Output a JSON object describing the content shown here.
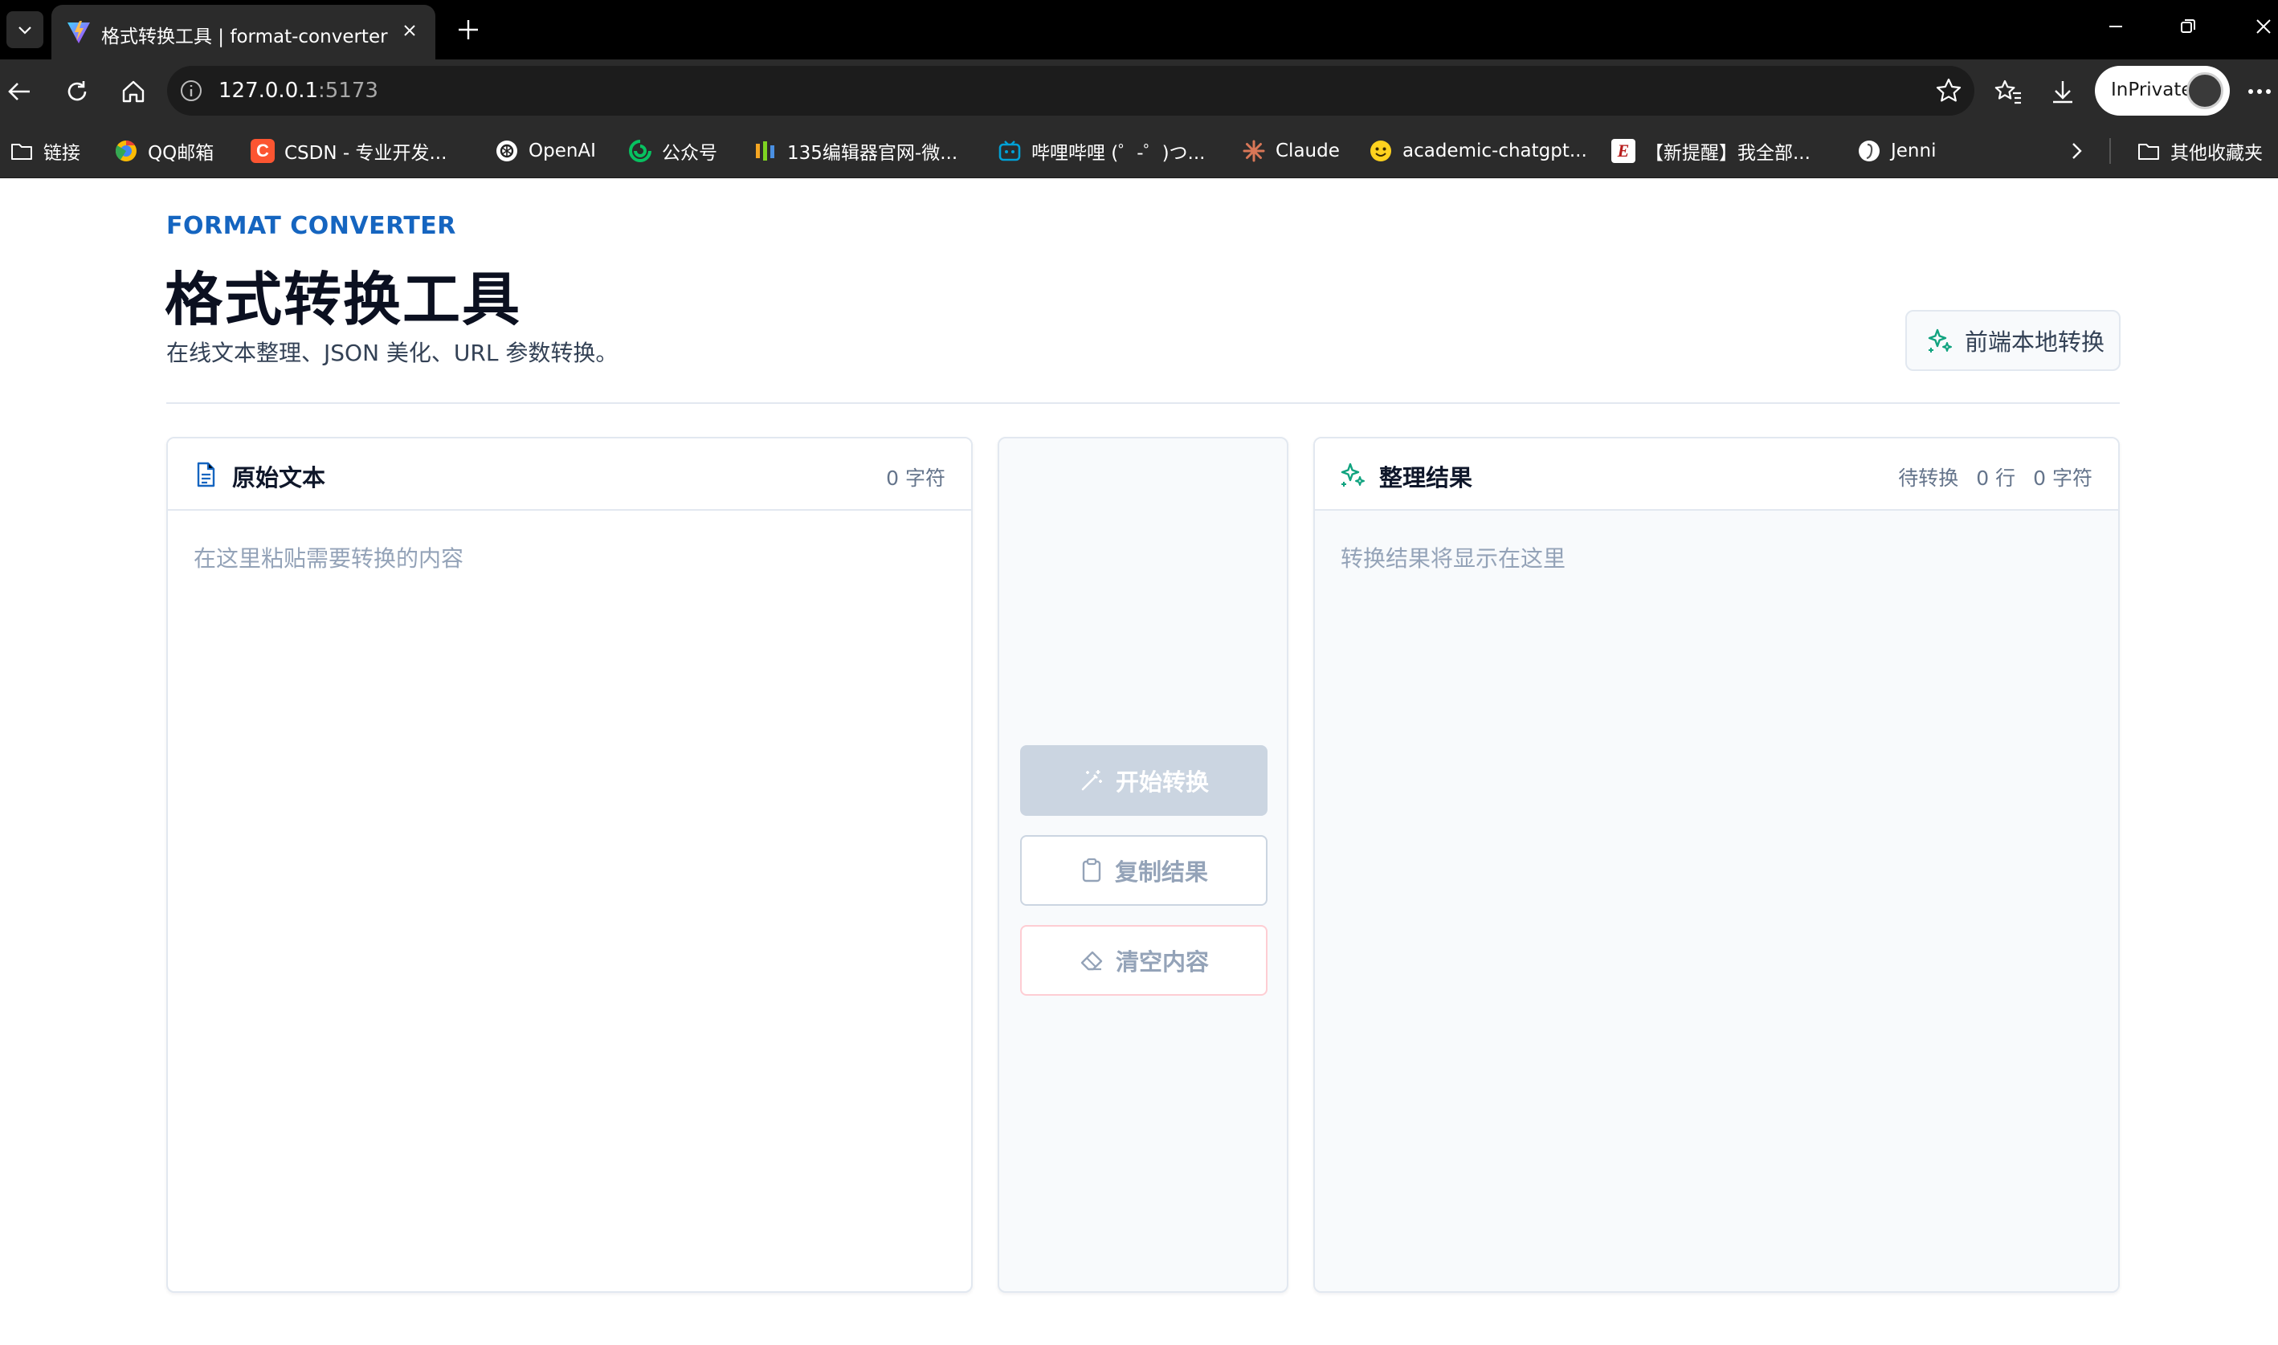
{
  "browser": {
    "tab_title": "格式转换工具 | format-converter",
    "url_host": "127.0.0.1",
    "url_port": ":5173",
    "inprivate_label": "InPrivate"
  },
  "bookmarks": [
    {
      "label": "链接",
      "icon": "folder-icon"
    },
    {
      "label": "QQ邮箱",
      "icon": "qqmail-icon"
    },
    {
      "label": "CSDN - 专业开发...",
      "icon": "csdn-icon"
    },
    {
      "label": "OpenAI",
      "icon": "openai-icon"
    },
    {
      "label": "公众号",
      "icon": "wechat-official-icon"
    },
    {
      "label": "135编辑器官网-微...",
      "icon": "editor135-icon"
    },
    {
      "label": "哔哩哔哩 (゜-゜)つ...",
      "icon": "bilibili-icon"
    },
    {
      "label": "Claude",
      "icon": "claude-icon"
    },
    {
      "label": "academic-chatgpt...",
      "icon": "huggingface-icon"
    },
    {
      "label": "【新提醒】我全部...",
      "icon": "e-site-icon"
    },
    {
      "label": "Jenni",
      "icon": "jenni-icon"
    }
  ],
  "other_bookmarks_label": "其他收藏夹",
  "header": {
    "eyebrow": "FORMAT CONVERTER",
    "title": "格式转换工具",
    "subtitle": "在线文本整理、JSON 美化、URL 参数转换。",
    "badge": "前端本地转换"
  },
  "input_panel": {
    "title": "原始文本",
    "char_count": "0 字符",
    "placeholder": "在这里粘贴需要转换的内容"
  },
  "actions": {
    "convert": "开始转换",
    "copy": "复制结果",
    "clear": "清空内容"
  },
  "output_panel": {
    "title": "整理结果",
    "status": "待转换",
    "line_count": "0 行",
    "char_count": "0 字符",
    "placeholder": "转换结果将显示在这里"
  },
  "colors": {
    "accent": "#1565c0",
    "sparkle": "#10a37f",
    "disabled_button": "#cbd5e1",
    "clear_border": "#fecdd3"
  }
}
